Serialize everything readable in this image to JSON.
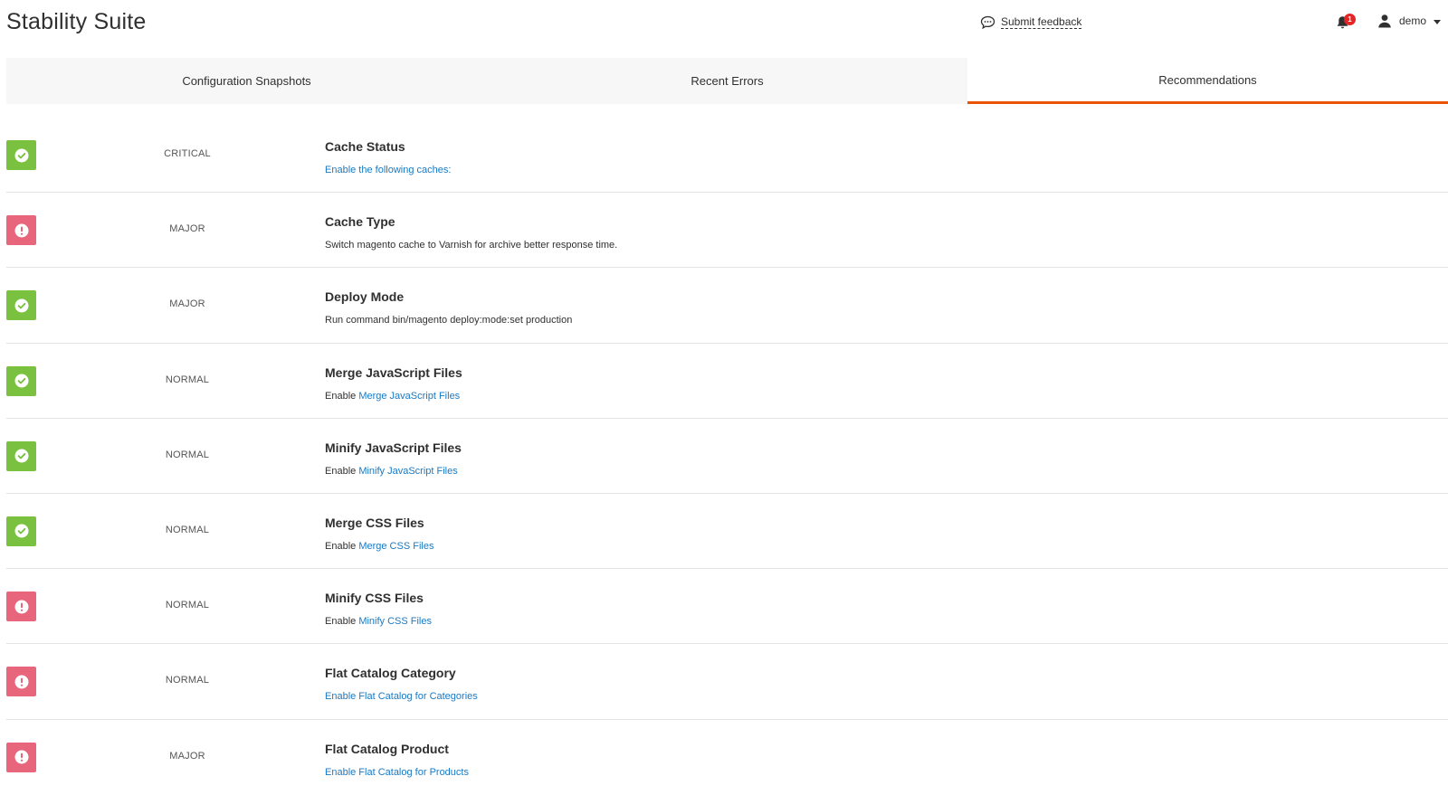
{
  "header": {
    "title": "Stability Suite",
    "feedback_label": "Submit feedback",
    "notification_count": "1",
    "user_name": "demo"
  },
  "tabs": [
    {
      "label": "Configuration Snapshots",
      "active": false
    },
    {
      "label": "Recent Errors",
      "active": false
    },
    {
      "label": "Recommendations",
      "active": true
    }
  ],
  "colors": {
    "accent": "#eb5202",
    "ok": "#79c13f",
    "error": "#e8667c",
    "link": "#1979c3"
  },
  "recommendations": [
    {
      "status": "ok",
      "severity": "CRITICAL",
      "title": "Cache Status",
      "desc_prefix": "",
      "desc_link": "Enable the following caches:"
    },
    {
      "status": "error",
      "severity": "MAJOR",
      "title": "Cache Type",
      "desc_prefix": "Switch magento cache to Varnish for archive better response time.",
      "desc_link": ""
    },
    {
      "status": "ok",
      "severity": "MAJOR",
      "title": "Deploy Mode",
      "desc_prefix": "Run command bin/magento deploy:mode:set production",
      "desc_link": ""
    },
    {
      "status": "ok",
      "severity": "NORMAL",
      "title": "Merge JavaScript Files",
      "desc_prefix": "Enable ",
      "desc_link": "Merge JavaScript Files"
    },
    {
      "status": "ok",
      "severity": "NORMAL",
      "title": "Minify JavaScript Files",
      "desc_prefix": "Enable ",
      "desc_link": "Minify JavaScript Files"
    },
    {
      "status": "ok",
      "severity": "NORMAL",
      "title": "Merge CSS Files",
      "desc_prefix": "Enable ",
      "desc_link": "Merge CSS Files"
    },
    {
      "status": "error",
      "severity": "NORMAL",
      "title": "Minify CSS Files",
      "desc_prefix": "Enable ",
      "desc_link": "Minify CSS Files"
    },
    {
      "status": "error",
      "severity": "NORMAL",
      "title": "Flat Catalog Category",
      "desc_prefix": "",
      "desc_link": "Enable Flat Catalog for Categories"
    },
    {
      "status": "error",
      "severity": "MAJOR",
      "title": "Flat Catalog Product",
      "desc_prefix": "",
      "desc_link": "Enable Flat Catalog for Products"
    }
  ]
}
